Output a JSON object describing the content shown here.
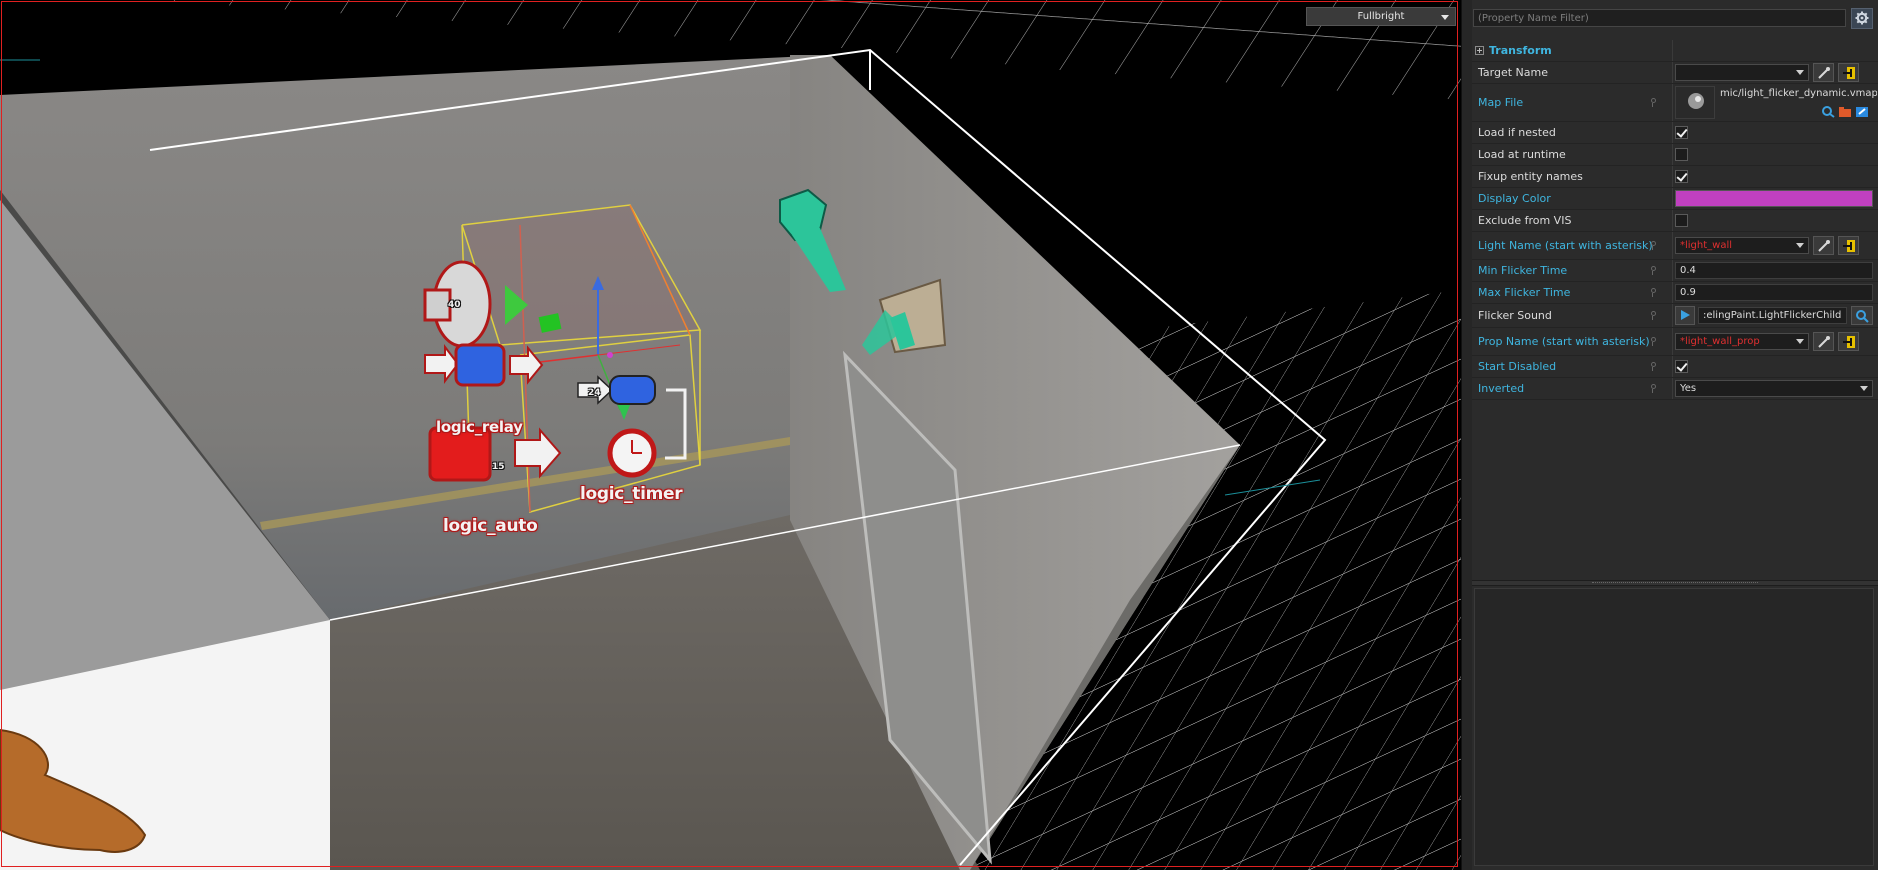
{
  "viewport": {
    "render_mode": "Fullbright",
    "entities": {
      "logic_auto": "logic_auto",
      "logic_timer": "logic_timer",
      "logic_relay": "logic_relay",
      "sound_number": "40",
      "relay_number": "15",
      "timer_number": "24"
    }
  },
  "panel": {
    "filter_placeholder": "(Property Name Filter)",
    "section": "Transform",
    "properties": {
      "target_name": {
        "label": "Target Name",
        "value": ""
      },
      "map_file": {
        "label": "Map File",
        "value": "mic/light_flicker_dynamic.vmap"
      },
      "load_if_nested": {
        "label": "Load if nested",
        "checked": true
      },
      "load_at_runtime": {
        "label": "Load at runtime",
        "checked": false
      },
      "fixup_entity_names": {
        "label": "Fixup entity names",
        "checked": true
      },
      "display_color": {
        "label": "Display Color",
        "color": "#c040c0"
      },
      "exclude_from_vis": {
        "label": "Exclude from VIS",
        "checked": false
      },
      "light_name": {
        "label": "Light Name (start with asterisk)",
        "value": "*light_wall"
      },
      "min_flicker": {
        "label": "Min Flicker Time",
        "value": "0.4"
      },
      "max_flicker": {
        "label": "Max Flicker Time",
        "value": "0.9"
      },
      "flicker_sound": {
        "label": "Flicker Sound",
        "value": ":elingPaint.LightFlickerChild"
      },
      "prop_name": {
        "label": "Prop Name (start with asterisk)",
        "value": "*light_wall_prop"
      },
      "start_disabled": {
        "label": "Start Disabled",
        "checked": true
      },
      "inverted": {
        "label": "Inverted",
        "value": "Yes"
      }
    }
  },
  "colors": {
    "accent": "#3fb6e0",
    "selection": "#e02020",
    "warning_text": "#e03030"
  }
}
